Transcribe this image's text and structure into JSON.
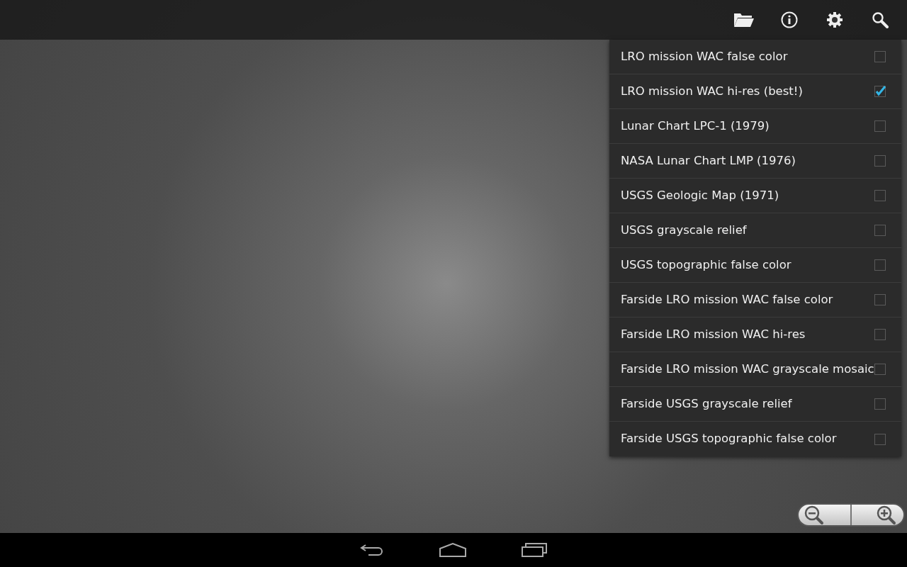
{
  "layers_menu": [
    {
      "label": "LRO mission WAC false color",
      "checked": false
    },
    {
      "label": "LRO mission WAC hi-res (best!)",
      "checked": true
    },
    {
      "label": "Lunar Chart LPC-1 (1979)",
      "checked": false
    },
    {
      "label": "NASA Lunar Chart LMP (1976)",
      "checked": false
    },
    {
      "label": "USGS Geologic Map (1971)",
      "checked": false
    },
    {
      "label": "USGS grayscale relief",
      "checked": false
    },
    {
      "label": "USGS topographic false color",
      "checked": false
    },
    {
      "label": "Farside LRO mission WAC false color",
      "checked": false
    },
    {
      "label": "Farside LRO mission WAC hi-res",
      "checked": false
    },
    {
      "label": "Farside LRO mission WAC grayscale mosaic",
      "checked": false
    },
    {
      "label": "Farside USGS grayscale relief",
      "checked": false
    },
    {
      "label": "Farside USGS topographic false color",
      "checked": false
    }
  ]
}
